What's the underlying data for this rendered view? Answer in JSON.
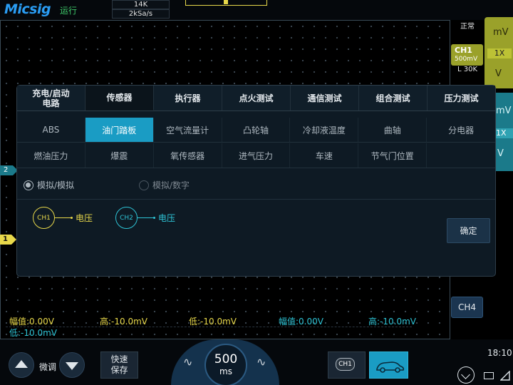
{
  "header": {
    "logo": "Micsig",
    "run_state": "运行",
    "memory_depth": "14K",
    "sample_rate": "2kSa/s"
  },
  "right_panel": {
    "status": "正常",
    "ch1_unit_top": "mV",
    "ch1_probe": "1X",
    "ch1_unit_bottom": "V",
    "ch1_label": "CH1",
    "ch1_scale": "500mV",
    "ch1_filter": "L 30K",
    "ch2_unit_top": "mV",
    "ch2_probe": "1X",
    "ch2_unit_bottom": "V",
    "ch4_label": "CH4"
  },
  "markers": {
    "ch2": "2",
    "ch1": "1"
  },
  "dialog": {
    "tabs": [
      {
        "label": "充电/启动\n电路"
      },
      {
        "label": "传感器"
      },
      {
        "label": "执行器"
      },
      {
        "label": "点火测试"
      },
      {
        "label": "通信测试"
      },
      {
        "label": "组合测试"
      },
      {
        "label": "压力测试"
      }
    ],
    "row1": [
      "ABS",
      "油门踏板",
      "空气流量计",
      "凸轮轴",
      "冷却液温度",
      "曲轴",
      "分电器"
    ],
    "row2": [
      "燃油压力",
      "爆震",
      "氧传感器",
      "进气压力",
      "车速",
      "节气门位置",
      ""
    ],
    "mode_options": [
      "模拟/模拟",
      "模拟/数字"
    ],
    "channels": [
      {
        "chip": "CH1",
        "signal": "电压"
      },
      {
        "chip": "CH2",
        "signal": "电压"
      }
    ],
    "ok_label": "确定"
  },
  "measurements": {
    "m1": "幅值:0.00V",
    "m2": "高:-10.0mV",
    "m3": "低:-10.0mV",
    "m4": "幅值:0.00V",
    "m5": "高:-10.0mV",
    "m6": "低:-10.0mV"
  },
  "bottom": {
    "fine_label": "微调",
    "quick_save": "快速\n保存",
    "timebase_value": "500",
    "timebase_unit": "ms",
    "ch1_chip": "CH1",
    "clock": "18:10"
  }
}
